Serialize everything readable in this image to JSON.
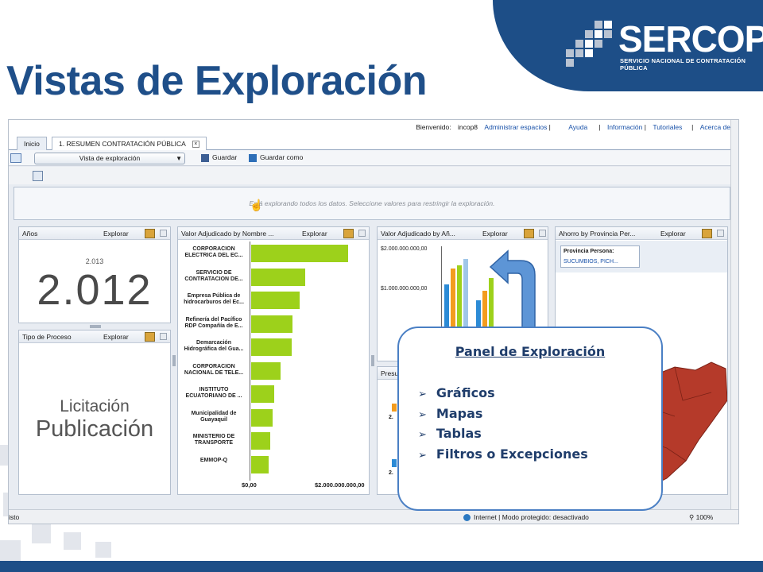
{
  "slide": {
    "title": "Vistas de Exploración",
    "logo_name": "SERCOP",
    "logo_subtitle": "SERVICIO NACIONAL DE CONTRATACIÓN PÚBLICA",
    "colors": {
      "brand_blue": "#1d4e87",
      "title_blue": "#1f4f89",
      "bar_green": "#9dd11b",
      "map_red": "#b53a2a"
    }
  },
  "browser": {
    "header": {
      "welcome": "Bienvenido:",
      "user": "incop8",
      "links": [
        "Administrar espacios",
        "Ayuda",
        "Información",
        "Tutoriales",
        "Acerca de"
      ]
    },
    "tabs": [
      "Inicio",
      "1. RESUMEN CONTRATACIÓN PÚBLICA"
    ],
    "toolbar": {
      "view_select": "Vista de exploración",
      "save": "Guardar",
      "save_as": "Guardar como"
    },
    "info_message": "Está explorando todos los datos. Seleccione valores para restringir la exploración.",
    "explore_label": "Explorar",
    "panels": {
      "anios": {
        "title": "Años",
        "sub_value": "2.013",
        "value": "2.012"
      },
      "tipo_proceso": {
        "title": "Tipo de Proceso",
        "line1": "Licitación",
        "line2": "Publicación"
      },
      "valor_nombre": {
        "title": "Valor Adjudicado by Nombre ...",
        "axis_min": "$0,00",
        "axis_max": "$2.000.000.000,00"
      },
      "valor_anio": {
        "title": "Valor Adjudicado by Añ...",
        "y_ticks": [
          "$2.000.000.000,00",
          "$1.000.000.000,00"
        ]
      },
      "ahorro": {
        "title": "Ahorro by Provincia Per...",
        "filter_label": "Provincia Persona:",
        "filter_value": "SUCUMBIOS, PICH..."
      },
      "presupuesto": {
        "title": "Presu",
        "ticks": [
          "2.",
          "2."
        ]
      }
    },
    "status": {
      "left": "isto",
      "mid": "Internet | Modo protegido: desactivado",
      "zoom": "100%"
    }
  },
  "chart_data": [
    {
      "type": "bar",
      "orientation": "horizontal",
      "title": "Valor Adjudicado by Nombre ...",
      "categories": [
        "CORPORACION ELECTRICA DEL EC...",
        "SERVICIO DE CONTRATACION DE...",
        "Empresa Pública de hidrocarburos del Ec...",
        "Refinería del Pacífico RDP Compañía de E...",
        "Demarcación Hidrográfica del Gua...",
        "CORPORACION NACIONAL DE TELE...",
        "INSTITUTO ECUATORIANO DE ...",
        "Municipalidad de Guayaquil",
        "MINISTERIO DE TRANSPORTE",
        "EMMOP-Q"
      ],
      "values": [
        1700000000,
        950000000,
        850000000,
        720000000,
        710000000,
        520000000,
        400000000,
        380000000,
        340000000,
        300000000
      ],
      "xlim": [
        0,
        2000000000
      ]
    }
  ],
  "callout": {
    "title": "Panel de Exploración",
    "items": [
      "Gráficos",
      "Mapas",
      "Tablas",
      "Filtros o Excepciones"
    ]
  }
}
